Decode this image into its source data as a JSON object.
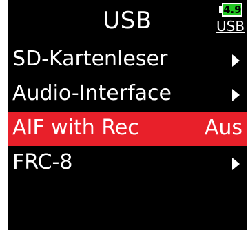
{
  "header": {
    "title": "USB",
    "battery_value": "4.9",
    "power_source": "USB",
    "battery_color": "#22c422"
  },
  "menu": {
    "items": [
      {
        "label": "SD-Kartenleser",
        "value": "",
        "icon": "chevron-right-icon"
      },
      {
        "label": "Audio-Interface",
        "value": "",
        "icon": "chevron-right-icon"
      },
      {
        "label": "AIF with Rec",
        "value": "Aus",
        "selected": true
      },
      {
        "label": "FRC-8",
        "value": "",
        "icon": "chevron-right-icon"
      }
    ]
  },
  "colors": {
    "background": "#000000",
    "selection": "#e8202a",
    "text": "#ffffff"
  }
}
